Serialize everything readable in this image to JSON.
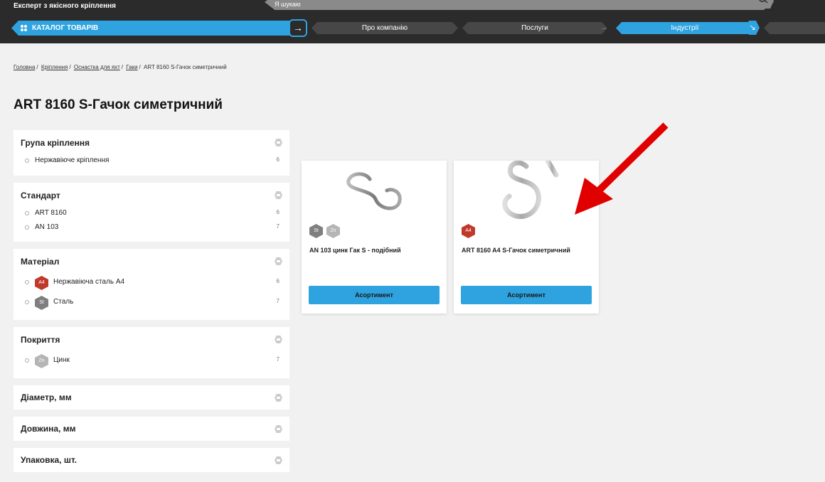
{
  "header": {
    "tagline": "Експерт з якісного кріплення",
    "search_placeholder": "Я шукаю",
    "catalog_label": "КАТАЛОГ ТОВАРІВ",
    "tabs": [
      {
        "label": "Про компанію"
      },
      {
        "label": "Послуги"
      },
      {
        "label": "Індустрії"
      }
    ],
    "colors": {
      "accent": "#2ea3df",
      "dark": "#2b2b2b"
    }
  },
  "breadcrumb": {
    "items": [
      "Головна",
      "Кріплення",
      "Оснастка для яхт",
      "Гаки"
    ],
    "current": "ART 8160 S-Гачок симетричний"
  },
  "page_title": "ART 8160 S-Гачок симетричний",
  "filters": [
    {
      "title": "Група кріплення",
      "options": [
        {
          "label": "Нержавіюче кріплення",
          "count": "6"
        }
      ]
    },
    {
      "title": "Стандарт",
      "options": [
        {
          "label": "ART 8160",
          "count": "6"
        },
        {
          "label": "AN 103",
          "count": "7"
        }
      ]
    },
    {
      "title": "Матеріал",
      "options": [
        {
          "label": "Нержавіюча сталь А4",
          "count": "6",
          "badge": "A4",
          "badge_color": "#c0392b"
        },
        {
          "label": "Сталь",
          "count": "7",
          "badge": "St",
          "badge_color": "#7f7f7f"
        }
      ]
    },
    {
      "title": "Покриття",
      "options": [
        {
          "label": "Цинк",
          "count": "7",
          "badge": "Zn",
          "badge_color": "#b5b5b5"
        }
      ]
    },
    {
      "title": "Діаметр, мм"
    },
    {
      "title": "Довжина, мм"
    },
    {
      "title": "Упаковка, шт."
    }
  ],
  "products": [
    {
      "name": "AN 103 цинк Гак S - подібний",
      "button": "Асортимент",
      "badges": [
        {
          "text": "St",
          "color": "#7f7f7f"
        },
        {
          "text": "Zn",
          "color": "#b5b5b5"
        }
      ]
    },
    {
      "name": "ART 8160 A4 S-Гачок симетричний",
      "button": "Асортимент",
      "badges": [
        {
          "text": "A4",
          "color": "#c0392b"
        }
      ]
    }
  ],
  "annotation_color": "#e00000"
}
